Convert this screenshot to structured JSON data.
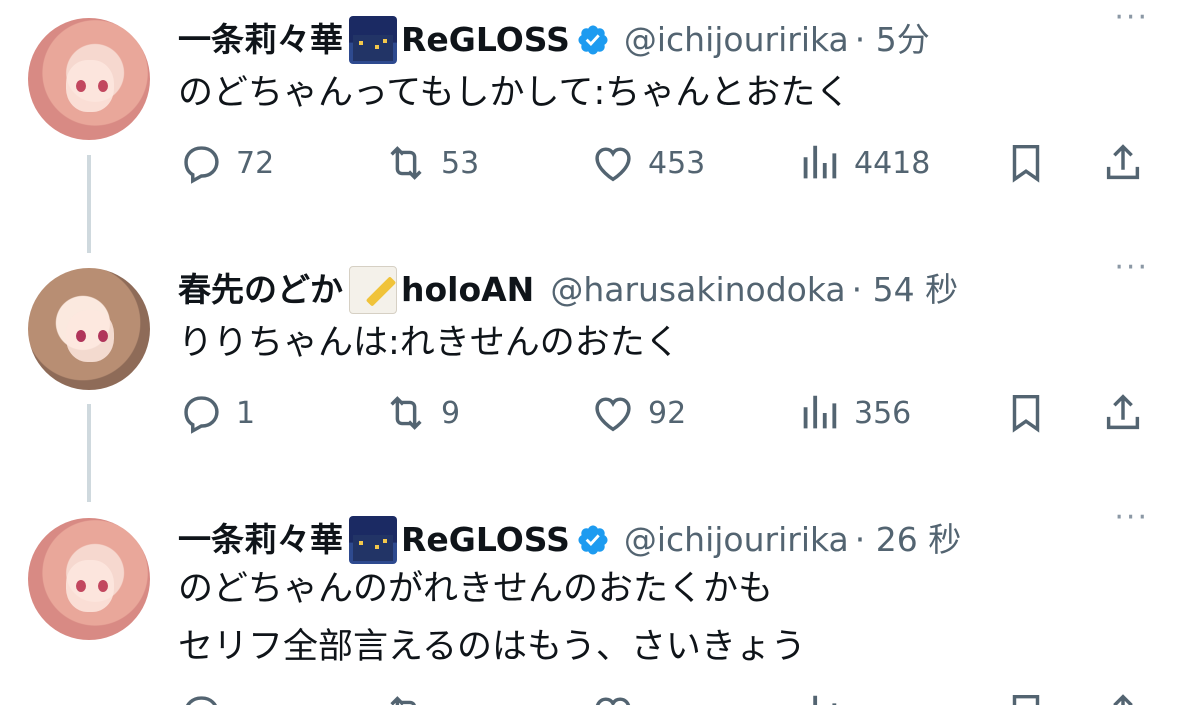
{
  "tweets": [
    {
      "name": "一条莉々華",
      "badge_emoji": "night-city-emoji",
      "group": "ReGLOSS",
      "verified": true,
      "handle": "@ichijouririka",
      "time": "· 5分",
      "text_lines": [
        "のどちゃんってもしかして:ちゃんとおたく"
      ],
      "reply_count": "72",
      "retweet_count": "53",
      "like_count": "453",
      "view_count": "4418"
    },
    {
      "name": "春先のどか",
      "badge_emoji": "memo-emoji",
      "group": "holoAN",
      "verified": false,
      "handle": "@harusakinodoka",
      "time": "· 54 秒",
      "text_lines": [
        "りりちゃんは:れきせんのおたく"
      ],
      "reply_count": "1",
      "retweet_count": "9",
      "like_count": "92",
      "view_count": "356"
    },
    {
      "name": "一条莉々華",
      "badge_emoji": "night-city-emoji",
      "group": "ReGLOSS",
      "verified": true,
      "handle": "@ichijouririka",
      "time": "· 26 秒",
      "text_lines": [
        "のどちゃんのがれきせんのおたくかも",
        "セリフ全部言えるのはもう、さいきょう"
      ]
    }
  ],
  "more_label": "···",
  "colors": {
    "text": "#0f1419",
    "secondary": "#536471",
    "verified": "#1d9bf0",
    "thread_line": "#cfd9de"
  }
}
